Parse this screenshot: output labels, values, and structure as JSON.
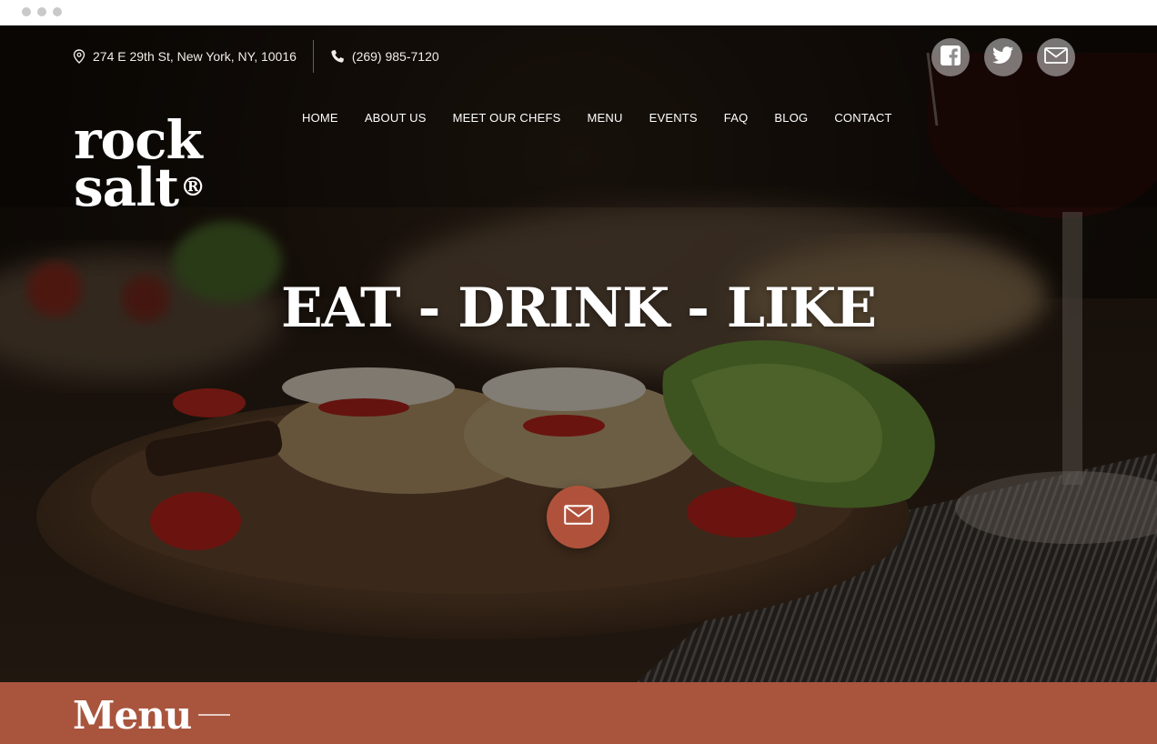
{
  "topbar": {
    "address": "274 E 29th St, New York, NY, 10016",
    "phone": "(269) 985-7120"
  },
  "social": {
    "icons": [
      "facebook-icon",
      "twitter-icon",
      "mail-icon"
    ]
  },
  "logo": {
    "line1": "rock",
    "line2": "salt",
    "mark": "®"
  },
  "nav": {
    "items": [
      "HOME",
      "ABOUT US",
      "MEET OUR CHEFS",
      "MENU",
      "EVENTS",
      "FAQ",
      "BLOG",
      "CONTACT"
    ]
  },
  "hero": {
    "headline": "EAT - DRINK - LIKE"
  },
  "section": {
    "title": "Menu"
  },
  "colors": {
    "accent": "#b0523b",
    "band": "#a9553e",
    "text_light": "#ffffff"
  }
}
